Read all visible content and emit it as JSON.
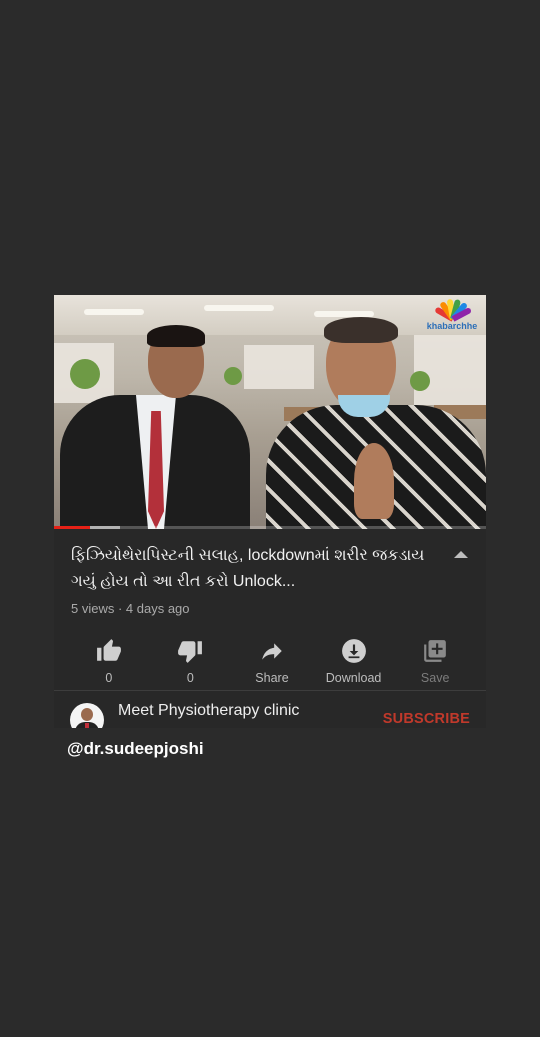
{
  "video": {
    "watermark": "khabarchhe",
    "progress_played_fraction": 0.083,
    "progress_buffered_fraction": 0.153
  },
  "meta": {
    "title": "ફિઝિયોથેરાપિસ્ટની સલાહ, lockdownમાં શરીર જકડાય ગયું હોય તો આ રીત કરો Unlock...",
    "stats": "5 views · 4 days ago"
  },
  "actions": [
    {
      "icon": "thumbs-up-icon",
      "label": "0"
    },
    {
      "icon": "thumbs-down-icon",
      "label": "0"
    },
    {
      "icon": "share-icon",
      "label": "Share"
    },
    {
      "icon": "download-icon",
      "label": "Download"
    },
    {
      "icon": "save-playlist-icon",
      "label": "Save"
    }
  ],
  "channel": {
    "name": "Meet Physiotherapy clinic",
    "subscribe_label": "SUBSCRIBE",
    "subscribe_color": "#c0392b"
  },
  "overlay": {
    "handle": "@dr.sudeepjoshi"
  },
  "colors": {
    "background": "#2b2b2b",
    "progress": "#e62117"
  }
}
